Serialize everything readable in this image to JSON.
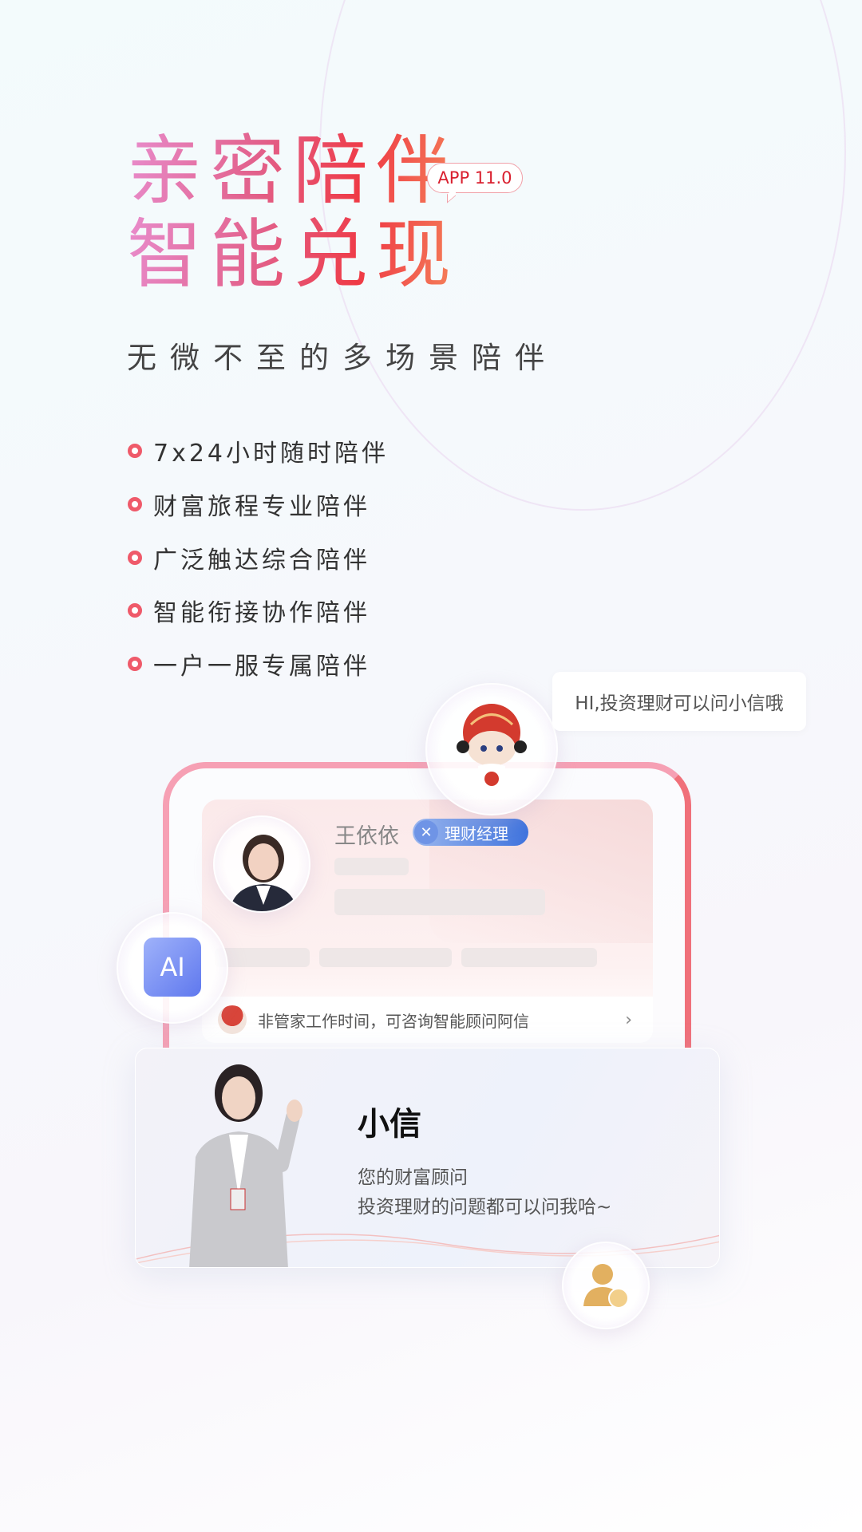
{
  "hero": {
    "title_line1": "亲密陪伴",
    "title_line2": "智能兑现",
    "version_badge": "APP 11.0",
    "subtitle": "无微不至的多场景陪伴"
  },
  "features": [
    "7x24小时随时陪伴",
    "财富旅程专业陪伴",
    "广泛触达综合陪伴",
    "智能衔接协作陪伴",
    "一户一服专属陪伴"
  ],
  "mascot_bubble": "HI,投资理财可以问小信哦",
  "manager_card": {
    "name": "王依依",
    "role_badge": "理财经理",
    "footer_text": "非管家工作时间，可咨询智能顾问阿信",
    "chevron_icon": "chevron-right-icon"
  },
  "ai_badge": "AI",
  "assistant_card": {
    "name": "小信",
    "line1": "您的财富顾问",
    "line2": "投资理财的问题都可以问我哈~"
  },
  "colors": {
    "accent": "#ef3a45",
    "bullet": "#ef5a6a",
    "role_badge": "#4a7fe0",
    "ai_badge": "#6b86f0"
  }
}
